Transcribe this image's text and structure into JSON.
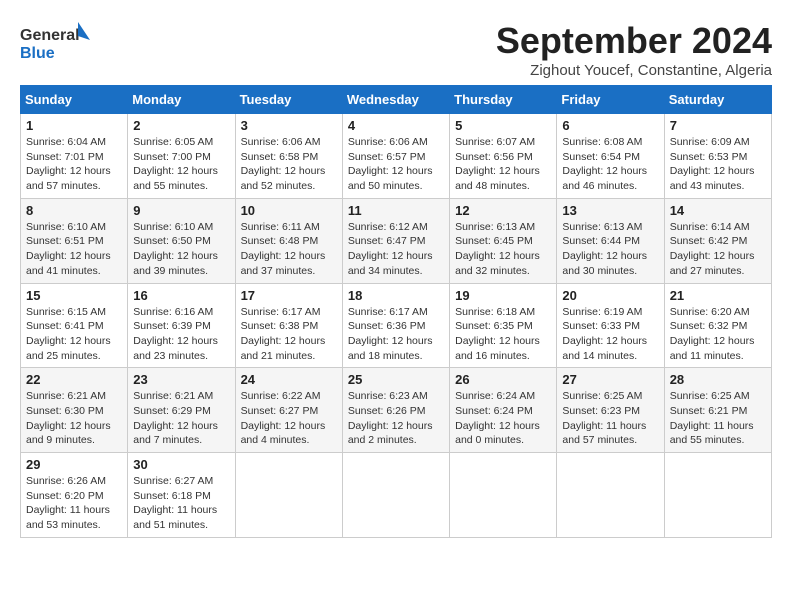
{
  "logo": {
    "line1": "General",
    "line2": "Blue"
  },
  "title": "September 2024",
  "subtitle": "Zighout Youcef, Constantine, Algeria",
  "days_of_week": [
    "Sunday",
    "Monday",
    "Tuesday",
    "Wednesday",
    "Thursday",
    "Friday",
    "Saturday"
  ],
  "weeks": [
    [
      {
        "day": "1",
        "sunrise": "6:04 AM",
        "sunset": "7:01 PM",
        "daylight": "12 hours and 57 minutes."
      },
      {
        "day": "2",
        "sunrise": "6:05 AM",
        "sunset": "7:00 PM",
        "daylight": "12 hours and 55 minutes."
      },
      {
        "day": "3",
        "sunrise": "6:06 AM",
        "sunset": "6:58 PM",
        "daylight": "12 hours and 52 minutes."
      },
      {
        "day": "4",
        "sunrise": "6:06 AM",
        "sunset": "6:57 PM",
        "daylight": "12 hours and 50 minutes."
      },
      {
        "day": "5",
        "sunrise": "6:07 AM",
        "sunset": "6:56 PM",
        "daylight": "12 hours and 48 minutes."
      },
      {
        "day": "6",
        "sunrise": "6:08 AM",
        "sunset": "6:54 PM",
        "daylight": "12 hours and 46 minutes."
      },
      {
        "day": "7",
        "sunrise": "6:09 AM",
        "sunset": "6:53 PM",
        "daylight": "12 hours and 43 minutes."
      }
    ],
    [
      {
        "day": "8",
        "sunrise": "6:10 AM",
        "sunset": "6:51 PM",
        "daylight": "12 hours and 41 minutes."
      },
      {
        "day": "9",
        "sunrise": "6:10 AM",
        "sunset": "6:50 PM",
        "daylight": "12 hours and 39 minutes."
      },
      {
        "day": "10",
        "sunrise": "6:11 AM",
        "sunset": "6:48 PM",
        "daylight": "12 hours and 37 minutes."
      },
      {
        "day": "11",
        "sunrise": "6:12 AM",
        "sunset": "6:47 PM",
        "daylight": "12 hours and 34 minutes."
      },
      {
        "day": "12",
        "sunrise": "6:13 AM",
        "sunset": "6:45 PM",
        "daylight": "12 hours and 32 minutes."
      },
      {
        "day": "13",
        "sunrise": "6:13 AM",
        "sunset": "6:44 PM",
        "daylight": "12 hours and 30 minutes."
      },
      {
        "day": "14",
        "sunrise": "6:14 AM",
        "sunset": "6:42 PM",
        "daylight": "12 hours and 27 minutes."
      }
    ],
    [
      {
        "day": "15",
        "sunrise": "6:15 AM",
        "sunset": "6:41 PM",
        "daylight": "12 hours and 25 minutes."
      },
      {
        "day": "16",
        "sunrise": "6:16 AM",
        "sunset": "6:39 PM",
        "daylight": "12 hours and 23 minutes."
      },
      {
        "day": "17",
        "sunrise": "6:17 AM",
        "sunset": "6:38 PM",
        "daylight": "12 hours and 21 minutes."
      },
      {
        "day": "18",
        "sunrise": "6:17 AM",
        "sunset": "6:36 PM",
        "daylight": "12 hours and 18 minutes."
      },
      {
        "day": "19",
        "sunrise": "6:18 AM",
        "sunset": "6:35 PM",
        "daylight": "12 hours and 16 minutes."
      },
      {
        "day": "20",
        "sunrise": "6:19 AM",
        "sunset": "6:33 PM",
        "daylight": "12 hours and 14 minutes."
      },
      {
        "day": "21",
        "sunrise": "6:20 AM",
        "sunset": "6:32 PM",
        "daylight": "12 hours and 11 minutes."
      }
    ],
    [
      {
        "day": "22",
        "sunrise": "6:21 AM",
        "sunset": "6:30 PM",
        "daylight": "12 hours and 9 minutes."
      },
      {
        "day": "23",
        "sunrise": "6:21 AM",
        "sunset": "6:29 PM",
        "daylight": "12 hours and 7 minutes."
      },
      {
        "day": "24",
        "sunrise": "6:22 AM",
        "sunset": "6:27 PM",
        "daylight": "12 hours and 4 minutes."
      },
      {
        "day": "25",
        "sunrise": "6:23 AM",
        "sunset": "6:26 PM",
        "daylight": "12 hours and 2 minutes."
      },
      {
        "day": "26",
        "sunrise": "6:24 AM",
        "sunset": "6:24 PM",
        "daylight": "12 hours and 0 minutes."
      },
      {
        "day": "27",
        "sunrise": "6:25 AM",
        "sunset": "6:23 PM",
        "daylight": "11 hours and 57 minutes."
      },
      {
        "day": "28",
        "sunrise": "6:25 AM",
        "sunset": "6:21 PM",
        "daylight": "11 hours and 55 minutes."
      }
    ],
    [
      {
        "day": "29",
        "sunrise": "6:26 AM",
        "sunset": "6:20 PM",
        "daylight": "11 hours and 53 minutes."
      },
      {
        "day": "30",
        "sunrise": "6:27 AM",
        "sunset": "6:18 PM",
        "daylight": "11 hours and 51 minutes."
      },
      null,
      null,
      null,
      null,
      null
    ]
  ]
}
